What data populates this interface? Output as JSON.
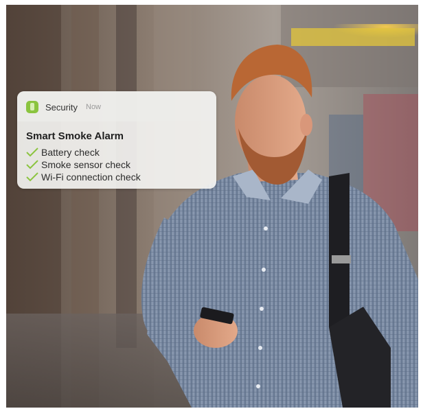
{
  "photo": {
    "description_icon": "man-looking-at-phone-photo"
  },
  "notification": {
    "app_name": "Security",
    "time": "Now",
    "title": "Smart Smoke Alarm",
    "icon": "security-app-icon",
    "accent_color": "#8bc43f",
    "items": [
      {
        "label": "Battery check",
        "icon": "check-icon"
      },
      {
        "label": "Smoke sensor check",
        "icon": "check-icon"
      },
      {
        "label": "Wi-Fi connection check",
        "icon": "check-icon"
      }
    ]
  }
}
